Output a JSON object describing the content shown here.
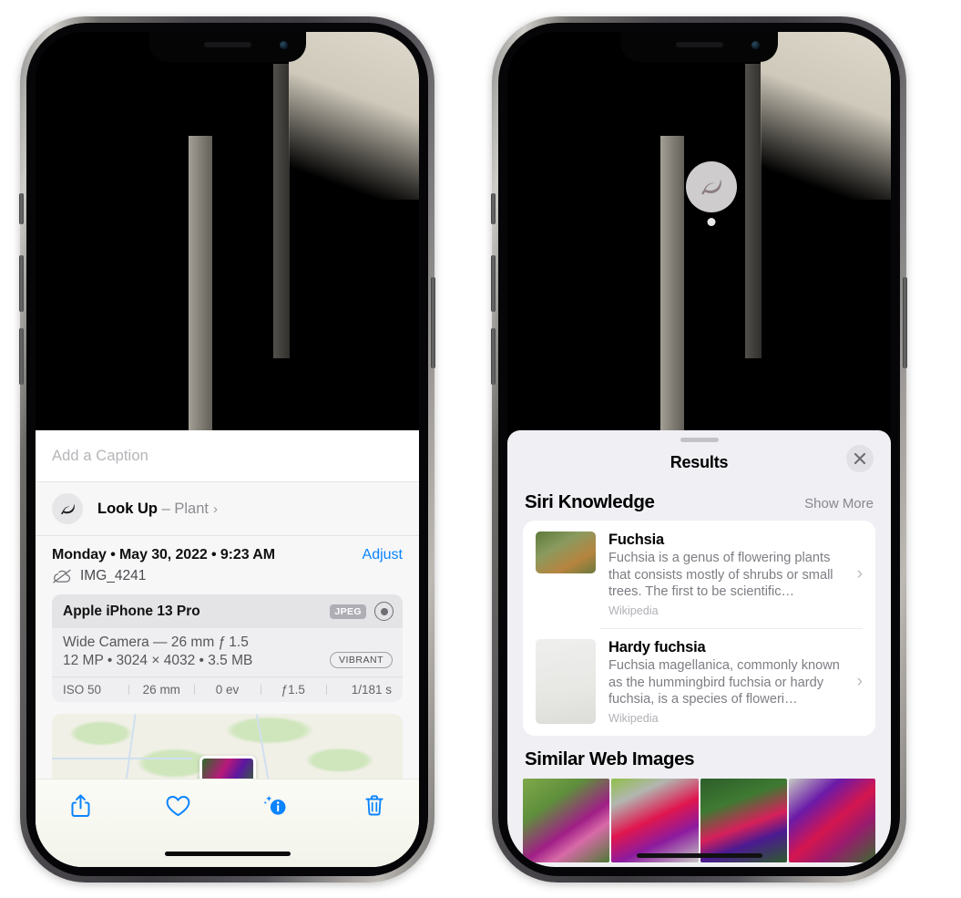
{
  "left_phone": {
    "caption": {
      "placeholder": "Add a Caption",
      "value": ""
    },
    "lookup": {
      "icon": "leaf-icon",
      "label": "Look Up",
      "dash": " – ",
      "subject": "Plant",
      "chevron": "›"
    },
    "date_row": {
      "date": "Monday • May 30, 2022 • 9:23 AM",
      "adjust": "Adjust"
    },
    "filename": {
      "icon": "cloud-slash-icon",
      "name": "IMG_4241"
    },
    "camera_card": {
      "device": "Apple iPhone 13 Pro",
      "format_tag": "JPEG",
      "lens_icon": "lens-icon",
      "line1": "Wide Camera — 26 mm ƒ 1.5",
      "line2": "12 MP • 3024 × 4032 • 3.5 MB",
      "style_tag": "VIBRANT",
      "exif": [
        "ISO 50",
        "26 mm",
        "0 ev",
        "ƒ1.5",
        "1/181 s"
      ]
    },
    "toolbar": [
      {
        "name": "share-icon",
        "label": "Share"
      },
      {
        "name": "favorite-icon",
        "label": "Favorite"
      },
      {
        "name": "info-icon",
        "label": "Info"
      },
      {
        "name": "trash-icon",
        "label": "Delete"
      }
    ]
  },
  "right_phone": {
    "badge": {
      "icon": "leaf-icon",
      "label": "Visual Look Up"
    },
    "sheet": {
      "title": "Results",
      "close_label": "Close"
    },
    "siri_knowledge": {
      "title": "Siri Knowledge",
      "show_more": "Show More",
      "items": [
        {
          "title": "Fuchsia",
          "desc": "Fuchsia is a genus of flowering plants that consists mostly of shrubs or small trees. The first to be scientific…",
          "source": "Wikipedia",
          "chevron": "›"
        },
        {
          "title": "Hardy fuchsia",
          "desc": "Fuchsia magellanica, commonly known as the hummingbird fuchsia or hardy fuchsia, is a species of floweri…",
          "source": "Wikipedia",
          "chevron": "›"
        }
      ]
    },
    "similar_web_images": {
      "title": "Similar Web Images",
      "count": 4
    }
  },
  "colors": {
    "accent_blue": "#0a84ff",
    "sheet_bg": "#f0eff4",
    "card_bg": "#ffffff",
    "muted_text": "#7d7d84",
    "tag_gray": "#aeaeb4"
  }
}
